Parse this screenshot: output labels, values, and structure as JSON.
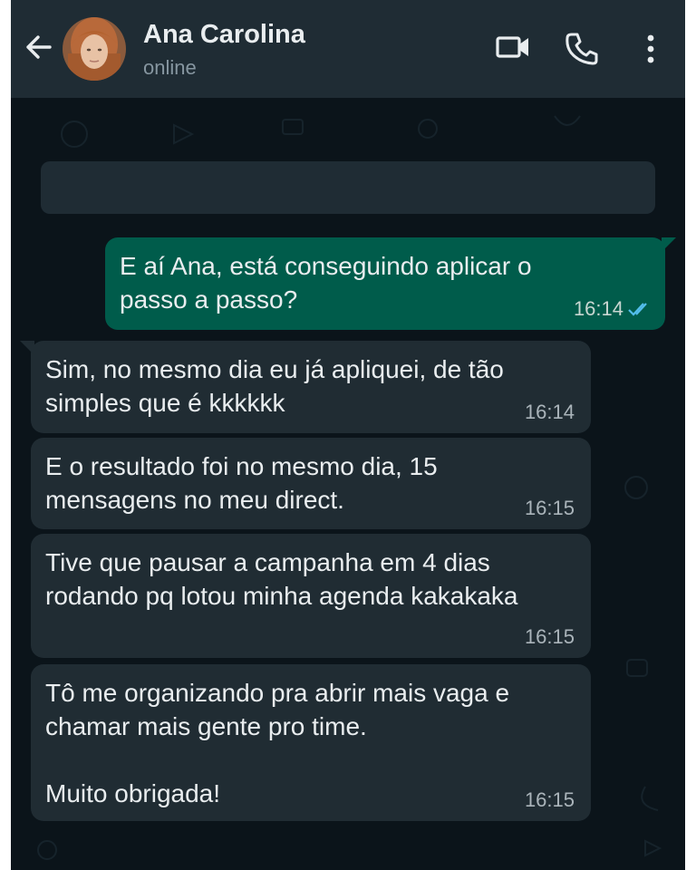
{
  "header": {
    "contact_name": "Ana Carolina",
    "status": "online",
    "icons": [
      "back-arrow-icon",
      "video-call-icon",
      "phone-icon",
      "more-options-icon"
    ]
  },
  "colors": {
    "header_bg": "#1f2c34",
    "chat_bg": "#0b141a",
    "incoming_bubble": "#202c33",
    "outgoing_bubble": "#005c4b",
    "read_ticks": "#53bdeb"
  },
  "messages": [
    {
      "direction": "outgoing",
      "text": "E aí Ana, está conseguindo aplicar o\npasso a passo?",
      "time": "16:14",
      "read": true
    },
    {
      "direction": "incoming",
      "text": "Sim, no mesmo dia eu já apliquei, de tão\nsimples que é kkkkkk",
      "time": "16:14"
    },
    {
      "direction": "incoming",
      "text": "E o resultado foi no mesmo dia, 15\nmensagens no meu direct.",
      "time": "16:15"
    },
    {
      "direction": "incoming",
      "text": "Tive que pausar a campanha em 4 dias\nrodando pq lotou minha agenda kakakaka",
      "time": "16:15"
    },
    {
      "direction": "incoming",
      "text": "Tô me organizando pra abrir mais vaga e\nchamar mais gente pro time.\n\nMuito obrigada!",
      "time": "16:15"
    }
  ]
}
